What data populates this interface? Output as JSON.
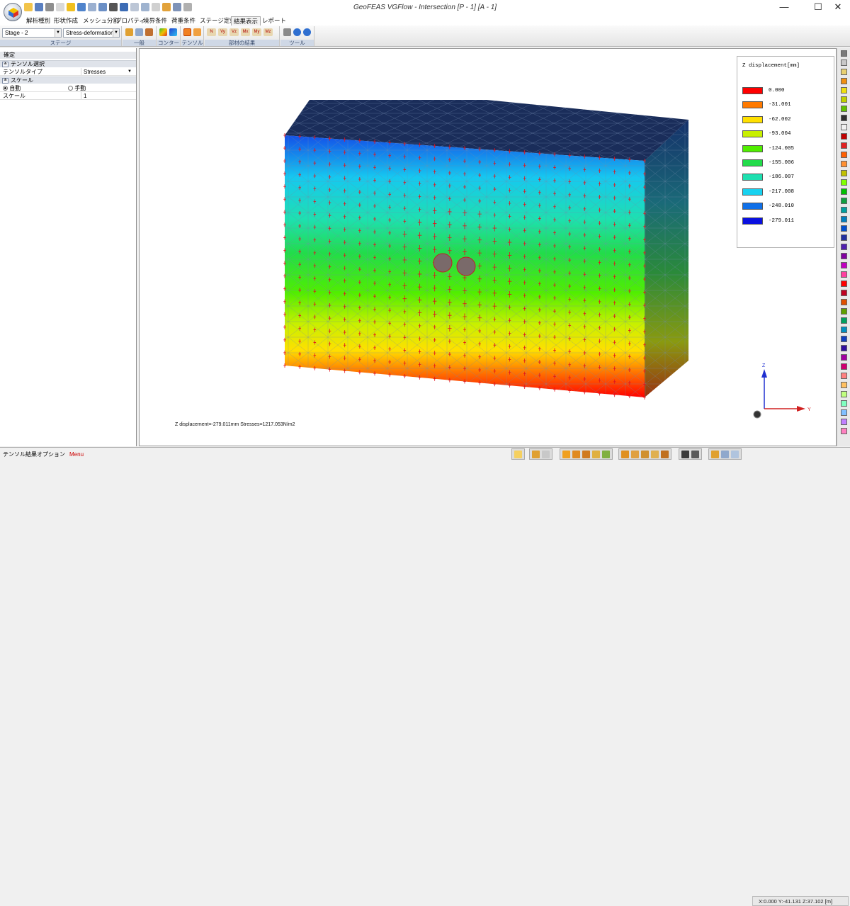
{
  "window": {
    "title": "GeoFEAS VGFlow - Intersection [P - 1] [A - 1]",
    "minimize": "—",
    "maximize": "☐",
    "close": "✕"
  },
  "menu": {
    "tabs": [
      "解析種別",
      "形状作成",
      "メッシュ分割",
      "プロパティ",
      "境界条件",
      "荷重条件",
      "ステージ定義",
      "結果表示",
      "レポート"
    ],
    "active_tab": "結果表示"
  },
  "ribbon": {
    "stage_select": "Stage - 2",
    "result_select": "Stress-deformation",
    "group_labels": [
      "ステージ",
      "一般",
      "コンター",
      "テンソル",
      "部材の結果",
      "ツール"
    ],
    "member_buttons": [
      "N",
      "Vy",
      "Vz",
      "Mx",
      "My",
      "Mz"
    ]
  },
  "panel": {
    "header": "確定",
    "section_tensor": "テンソル選択",
    "tensor_type_label": "テンソルタイプ",
    "tensor_type_value": "Stresses",
    "section_scale": "スケール",
    "auto_label": "自動",
    "manual_label": "手動",
    "scale_label": "スケール",
    "scale_value": "1",
    "expand_glyph": "≚"
  },
  "legend": {
    "title": "Z displacement[mm]",
    "items": [
      {
        "label": "0.000",
        "color": "#ff0000"
      },
      {
        "label": "-31.001",
        "color": "#ff7a00"
      },
      {
        "label": "-62.002",
        "color": "#ffe000"
      },
      {
        "label": "-93.004",
        "color": "#c8f000"
      },
      {
        "label": "-124.005",
        "color": "#50ee00"
      },
      {
        "label": "-155.006",
        "color": "#22dc4a"
      },
      {
        "label": "-186.007",
        "color": "#1ee0b0"
      },
      {
        "label": "-217.008",
        "color": "#18d2f0"
      },
      {
        "label": "-248.010",
        "color": "#1070e8"
      },
      {
        "label": "-279.011",
        "color": "#0a10e0"
      }
    ]
  },
  "viewport": {
    "status": "Z displacement=-279.011mm  Stresses=1217.053N/m2",
    "axes": {
      "z": "Z",
      "y": "Y"
    }
  },
  "colors": {
    "block_top": "#1a2d5a",
    "mesh": "#7a8fa8",
    "tensor": "#e0141e"
  },
  "palette": [
    "#7a7a7a",
    "#c8c8c8",
    "#e8d070",
    "#f09010",
    "#f0e010",
    "#c0d000",
    "#60c000",
    "#303030",
    "#f0f0f0",
    "#c00000",
    "#e02020",
    "#ff6000",
    "#ff9030",
    "#c0c000",
    "#80ff00",
    "#00c000",
    "#10a040",
    "#00a0a0",
    "#0080c0",
    "#0050d0",
    "#2030a0",
    "#5020b0",
    "#8000a0",
    "#c000c0",
    "#ff40a0",
    "#ff0000",
    "#c00020",
    "#e05000",
    "#60a000",
    "#00a060",
    "#0090c0",
    "#1040c0",
    "#3010a0",
    "#a000a0",
    "#d00070",
    "#ff8080",
    "#ffc060",
    "#c0ff80",
    "#80ffc0",
    "#80c0ff",
    "#c080ff",
    "#ff80c0"
  ],
  "statusbar": {
    "left_text": "テンソル結果オプション",
    "menu_text": "Menu",
    "coords": "X:0.000 Y:-41.131 Z:37.102 [m]"
  }
}
